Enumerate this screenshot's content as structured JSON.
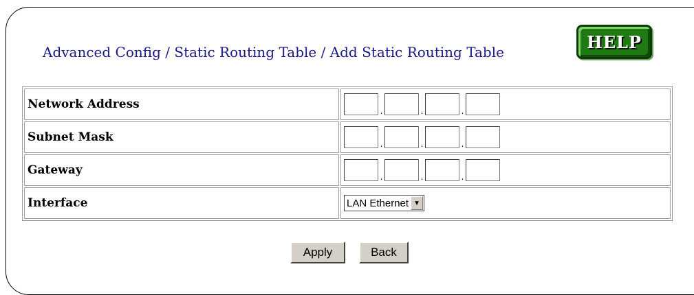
{
  "page": {
    "title": "Advanced Config / Static Routing Table / Add Static Routing Table",
    "help_label": "HELP"
  },
  "form": {
    "rows": [
      {
        "label": "Network Address",
        "octets": [
          "",
          "",
          "",
          ""
        ]
      },
      {
        "label": "Subnet Mask",
        "octets": [
          "",
          "",
          "",
          ""
        ]
      },
      {
        "label": "Gateway",
        "octets": [
          "",
          "",
          "",
          ""
        ]
      },
      {
        "label": "Interface",
        "selected": "LAN Ethernet"
      }
    ],
    "separator": "."
  },
  "buttons": {
    "apply": "Apply",
    "back": "Back"
  },
  "colors": {
    "title": "#1a1a8c",
    "help_bg": "#1f7a12",
    "button_face": "#d4d0c8"
  },
  "icons": {
    "dropdown": "triangle-down"
  }
}
